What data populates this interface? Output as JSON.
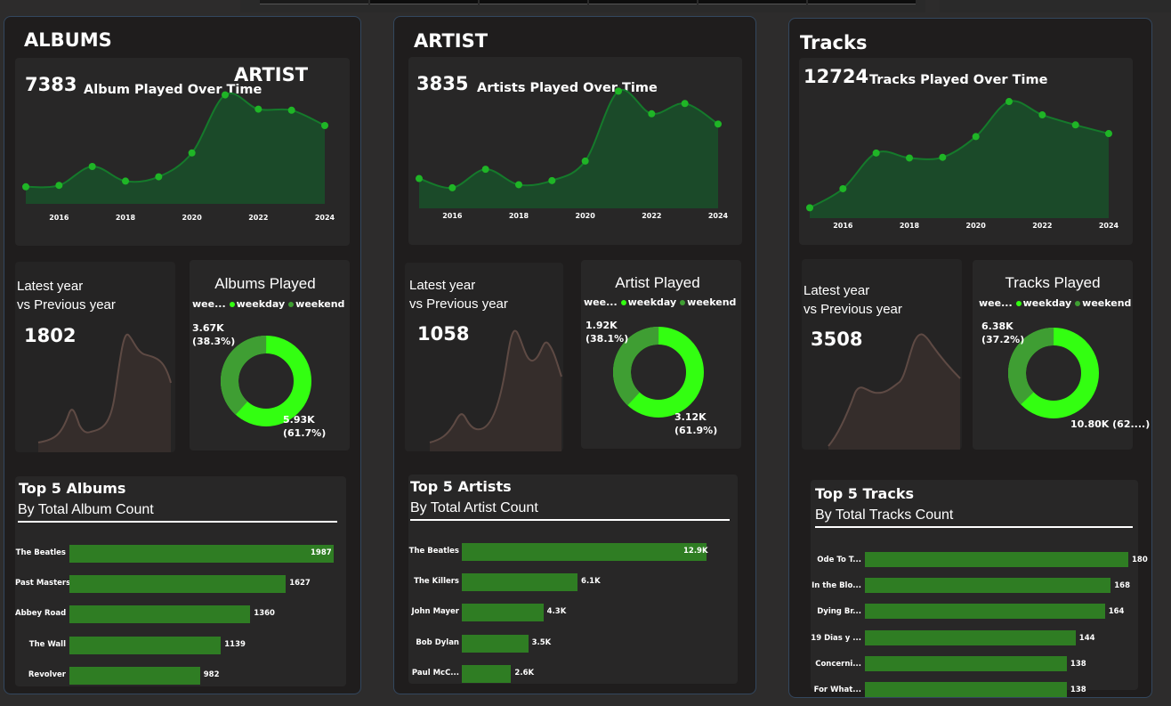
{
  "colors": {
    "area_fill": "#1b4a29",
    "line": "#157a2b",
    "point": "#1fb526",
    "weekday": "#3f9e33",
    "weekend": "#33ff11",
    "bar": "#2f7d23",
    "mini_area": "#352d2b"
  },
  "years": [
    "2016",
    "2018",
    "2020",
    "2022",
    "2024"
  ],
  "panels": [
    {
      "key": "albums",
      "title": "ALBUMS",
      "overlay": "ARTIST",
      "total": "7383",
      "chart_title": "Album Played Over Time",
      "latest_label_1": "Latest year",
      "latest_label_2": "vs Previous year",
      "latest_value": "1802",
      "donut_title": "Albums Played",
      "legend_lead": "wee...",
      "legend_weekday": "weekday",
      "legend_weekend": "weekend",
      "donut_small_value": "3.67K",
      "donut_small_pct": "(38.3%)",
      "donut_large_value": "5.93K",
      "donut_large_pct": "(61.7%)",
      "donut_small_frac": 0.383,
      "top5_title": "Top 5 Albums",
      "top5_sub": "By Total Album Count"
    },
    {
      "key": "artist",
      "title": "ARTIST",
      "total": "3835",
      "chart_title": "Artists Played Over Time",
      "latest_label_1": "Latest year",
      "latest_label_2": "vs Previous year",
      "latest_value": "1058",
      "donut_title": "Artist Played",
      "legend_lead": "wee...",
      "legend_weekday": "weekday",
      "legend_weekend": "weekend",
      "donut_small_value": "1.92K",
      "donut_small_pct": "(38.1%)",
      "donut_large_value": "3.12K",
      "donut_large_pct": "(61.9%)",
      "donut_small_frac": 0.381,
      "top5_title": "Top 5 Artists",
      "top5_sub": "By Total Artist Count"
    },
    {
      "key": "tracks",
      "title": "Tracks",
      "total": "12724",
      "chart_title": "Tracks Played Over Time",
      "latest_label_1": "Latest year",
      "latest_label_2": "vs Previous year",
      "latest_value": "3508",
      "donut_title": "Tracks Played",
      "legend_lead": "wee...",
      "legend_weekday": "weekday",
      "legend_weekend": "weekend",
      "donut_small_value": "6.38K",
      "donut_small_pct": "(37.2%)",
      "donut_large_value": "10.80K (62....)",
      "donut_large_pct": "",
      "donut_small_frac": 0.372,
      "top5_title": "Top 5 Tracks",
      "top5_sub": "By Total Tracks Count"
    }
  ],
  "chart_data": [
    {
      "type": "area",
      "panel": "albums",
      "x": [
        2015,
        2016,
        2017,
        2018,
        2019,
        2020,
        2021,
        2022,
        2023,
        2024
      ],
      "values": [
        480,
        520,
        1050,
        640,
        760,
        1430,
        3060,
        2660,
        2630,
        2200
      ],
      "ylim": [
        0,
        3400
      ]
    },
    {
      "type": "area",
      "panel": "artist",
      "x": [
        2015,
        2016,
        2017,
        2018,
        2019,
        2020,
        2021,
        2022,
        2023,
        2024
      ],
      "values": [
        290,
        200,
        380,
        230,
        270,
        460,
        1140,
        920,
        1020,
        820
      ],
      "ylim": [
        0,
        1230
      ]
    },
    {
      "type": "area",
      "panel": "tracks",
      "x": [
        2015,
        2016,
        2017,
        2018,
        2019,
        2020,
        2021,
        2022,
        2023,
        2024
      ],
      "values": [
        310,
        880,
        1950,
        1800,
        1820,
        2440,
        3490,
        3090,
        2790,
        2530
      ],
      "ylim": [
        0,
        4050
      ]
    },
    {
      "type": "bar",
      "panel": "albums",
      "categories": [
        "The Beatles",
        "Past Masters",
        "Abbey Road",
        "The Wall",
        "Revolver"
      ],
      "values": [
        1987,
        1627,
        1360,
        1139,
        982
      ],
      "labels": [
        "1987",
        "1627",
        "1360",
        "1139",
        "982"
      ]
    },
    {
      "type": "bar",
      "panel": "artist",
      "categories": [
        "The Beatles",
        "The Killers",
        "John Mayer",
        "Bob Dylan",
        "Paul McC..."
      ],
      "values": [
        12900,
        6100,
        4300,
        3500,
        2600
      ],
      "labels": [
        "12.9K",
        "6.1K",
        "4.3K",
        "3.5K",
        "2.6K"
      ]
    },
    {
      "type": "bar",
      "panel": "tracks",
      "categories": [
        "Ode To T...",
        "In the Blo...",
        "Dying Br...",
        "19 Dias y ...",
        "Concerni...",
        "For What..."
      ],
      "values": [
        180,
        168,
        164,
        144,
        138,
        138
      ],
      "labels": [
        "180",
        "168",
        "164",
        "144",
        "138",
        "138"
      ]
    }
  ]
}
